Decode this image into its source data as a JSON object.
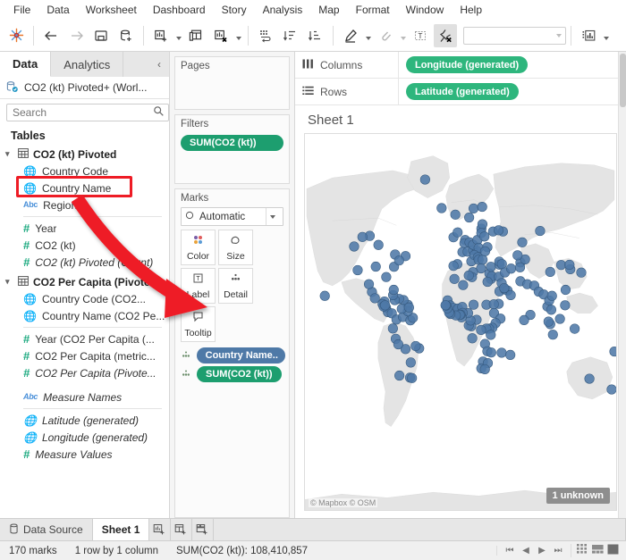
{
  "menu": {
    "items": [
      "File",
      "Data",
      "Worksheet",
      "Dashboard",
      "Story",
      "Analysis",
      "Map",
      "Format",
      "Window",
      "Help"
    ]
  },
  "toolbar": {
    "logo": "tableau-logo-icon",
    "back": "back-arrow-icon",
    "forward": "forward-arrow-icon",
    "save": "save-icon",
    "new_data_source": "new-data-source-icon",
    "new_worksheet": "new-worksheet-icon",
    "new_dashboard": "new-dashboard-icon",
    "clear_sheet": "clear-sheet-icon",
    "swap": "swap-rows-columns-icon",
    "sort_asc": "sort-ascending-icon",
    "sort_desc": "sort-descending-icon",
    "highlight": "highlight-icon",
    "group": "group-members-icon",
    "labels": "show-mark-labels-icon",
    "fix_axes": "fix-axes-icon",
    "fit_value": "",
    "fit_placeholder": "",
    "show_me": "show-me-icon"
  },
  "datapane": {
    "tabs": [
      {
        "label": "Data",
        "selected": true
      },
      {
        "label": "Analytics",
        "selected": false
      }
    ],
    "collapse_icon": "‹",
    "source": "CO2 (kt) Pivoted+ (Worl...",
    "search": {
      "placeholder": "Search",
      "value": ""
    },
    "search_icon": "search-icon",
    "filter_icon": "filter-icon",
    "grid_icon": "grid-view-icon",
    "grid_caret": "chevron-down-icon",
    "tables_header": "Tables",
    "tables": [
      {
        "name": "CO2 (kt) Pivoted",
        "fields": [
          {
            "label": "Country Code",
            "icon": "globe",
            "italic": false,
            "highlighted": false
          },
          {
            "label": "Country Name",
            "icon": "globe",
            "italic": false,
            "highlighted": true
          },
          {
            "label": "Region",
            "icon": "abc",
            "italic": false,
            "highlighted": false
          },
          {
            "label": "Year",
            "icon": "hash",
            "italic": false,
            "highlighted": false
          },
          {
            "label": "CO2 (kt)",
            "icon": "hash",
            "italic": false,
            "highlighted": false
          },
          {
            "label": "CO2 (kt) Pivoted (Count)",
            "icon": "hash",
            "italic": true,
            "highlighted": false
          }
        ]
      },
      {
        "name": "CO2 Per Capita (Pivoted)",
        "fields": [
          {
            "label": "Country Code (CO2...",
            "icon": "globe",
            "italic": false,
            "highlighted": false
          },
          {
            "label": "Country Name (CO2 Pe...",
            "icon": "globe",
            "italic": false,
            "highlighted": false
          },
          {
            "label": "Year (CO2 Per Capita (...",
            "icon": "hash",
            "italic": false,
            "highlighted": false
          },
          {
            "label": "CO2 Per Capita (metric...",
            "icon": "hash",
            "italic": false,
            "highlighted": false
          },
          {
            "label": "CO2 Per Capita (Pivote...",
            "icon": "hash",
            "italic": true,
            "highlighted": false
          }
        ]
      }
    ],
    "generated": [
      {
        "label": "Measure Names",
        "icon": "abc",
        "italic": true
      },
      {
        "label": "Latitude (generated)",
        "icon": "globe-green",
        "italic": true
      },
      {
        "label": "Longitude (generated)",
        "icon": "globe-green",
        "italic": true
      },
      {
        "label": "Measure Values",
        "icon": "hash",
        "italic": true
      }
    ]
  },
  "shelfpane": {
    "pages": {
      "title": "Pages"
    },
    "filters": {
      "title": "Filters",
      "pills": [
        "SUM(CO2 (kt))"
      ]
    },
    "marks": {
      "title": "Marks",
      "type": "Automatic",
      "type_icon": "circle-icon",
      "buttons": [
        {
          "label": "Color",
          "icon": "color-icon"
        },
        {
          "label": "Size",
          "icon": "size-icon"
        },
        {
          "label": "Label",
          "icon": "label-icon"
        },
        {
          "label": "Detail",
          "icon": "detail-icon"
        },
        {
          "label": "Tooltip",
          "icon": "tooltip-icon"
        }
      ],
      "pills": [
        {
          "label": "Country Name..",
          "color": "blue",
          "icon": "detail-icon"
        },
        {
          "label": "SUM(CO2 (kt))",
          "color": "green",
          "icon": "detail-icon"
        }
      ]
    }
  },
  "shelves": [
    {
      "name": "Columns",
      "icon": "columns-icon",
      "pills": [
        "Longitude (generated)"
      ]
    },
    {
      "name": "Rows",
      "icon": "rows-icon",
      "pills": [
        "Latitude (generated)"
      ]
    }
  ],
  "sheet": {
    "title": "Sheet 1",
    "map_attribution": "© Mapbox © OSM",
    "unknown_badge": "1 unknown"
  },
  "bottom_tabs": {
    "data_source": "Data Source",
    "data_source_icon": "data-source-icon",
    "sheets": [
      {
        "label": "Sheet 1",
        "selected": true
      }
    ],
    "new_worksheet_icon": "new-worksheet-icon",
    "new_dashboard_icon": "new-dashboard-icon",
    "new_story_icon": "new-story-icon"
  },
  "status": {
    "marks": "170 marks",
    "dimensions": "1 row by 1 column",
    "aggregate": "SUM(CO2 (kt)): 108,410,857",
    "nav": [
      "⏮",
      "◀",
      "▶",
      "⏭"
    ],
    "views": [
      "grid-view-icon",
      "filmstrip-view-icon",
      "sheet-view-icon"
    ]
  },
  "colors": {
    "tableau_green": "#1d9e6f",
    "shelf_green": "#2eb67d",
    "detail_blue": "#4e79a7",
    "mark_blue": "#4e79a7",
    "annotation_red": "#ee1c25",
    "land": "#e3e3e3",
    "water": "#ffffff"
  },
  "chart_data": {
    "type": "scatter",
    "title": "Sheet 1",
    "xlabel": "Longitude (generated)",
    "ylabel": "Latitude (generated)",
    "mark_count": 170,
    "mark_color": "#4e79a7",
    "unknown_locations": 1,
    "points": [
      [
        -21.9,
        64.1
      ],
      [
        -8.2,
        53.4
      ],
      [
        -3.4,
        55.4
      ],
      [
        -6.0,
        62.0
      ],
      [
        10.0,
        61.0
      ],
      [
        15.0,
        64.0
      ],
      [
        25.0,
        64.5
      ],
      [
        -41.0,
        71.7
      ],
      [
        5.3,
        52.2
      ],
      [
        4.5,
        50.8
      ],
      [
        2.2,
        46.6
      ],
      [
        10.4,
        51.2
      ],
      [
        8.2,
        46.8
      ],
      [
        14.5,
        47.5
      ],
      [
        12.5,
        41.9
      ],
      [
        -3.7,
        40.4
      ],
      [
        -8.2,
        39.4
      ],
      [
        19.1,
        47.2
      ],
      [
        14.5,
        50.1
      ],
      [
        19.5,
        52.2
      ],
      [
        21.0,
        48.7
      ],
      [
        16.0,
        45.1
      ],
      [
        20.0,
        44.0
      ],
      [
        21.0,
        42.7
      ],
      [
        25.5,
        42.7
      ],
      [
        23.7,
        38.0
      ],
      [
        33.4,
        35.1
      ],
      [
        14.4,
        35.9
      ],
      [
        24.1,
        56.9
      ],
      [
        25.3,
        58.6
      ],
      [
        24.0,
        55.2
      ],
      [
        27.6,
        53.7
      ],
      [
        31.0,
        49.0
      ],
      [
        28.4,
        47.0
      ],
      [
        35.2,
        31.8
      ],
      [
        36.2,
        33.5
      ],
      [
        44.4,
        33.2
      ],
      [
        35.2,
        38.9
      ],
      [
        45.0,
        40.1
      ],
      [
        44.8,
        41.7
      ],
      [
        47.9,
        40.4
      ],
      [
        51.4,
        35.7
      ],
      [
        45.0,
        24.0
      ],
      [
        47.5,
        29.3
      ],
      [
        51.5,
        25.3
      ],
      [
        54.4,
        24.5
      ],
      [
        50.5,
        26.1
      ],
      [
        58.0,
        21.5
      ],
      [
        44.2,
        15.6
      ],
      [
        31.2,
        30.0
      ],
      [
        13.2,
        32.9
      ],
      [
        9.5,
        33.9
      ],
      [
        3.0,
        28.0
      ],
      [
        -7.1,
        31.8
      ],
      [
        -15.0,
        18.0
      ],
      [
        -12.0,
        14.5
      ],
      [
        -8.0,
        12.7
      ],
      [
        -3.0,
        12.3
      ],
      [
        2.0,
        13.5
      ],
      [
        15.0,
        15.0
      ],
      [
        30.0,
        15.0
      ],
      [
        38.5,
        15.3
      ],
      [
        38.8,
        9.1
      ],
      [
        46.2,
        5.2
      ],
      [
        40.5,
        2.0
      ],
      [
        36.8,
        -1.3
      ],
      [
        32.9,
        -1.9
      ],
      [
        29.9,
        -1.9
      ],
      [
        34.9,
        -6.4
      ],
      [
        28.3,
        -12.8
      ],
      [
        31.0,
        -17.8
      ],
      [
        25.9,
        -24.7
      ],
      [
        24.0,
        -29.0
      ],
      [
        31.5,
        -25.7
      ],
      [
        28.2,
        -29.6
      ],
      [
        35.5,
        -18.7
      ],
      [
        47.5,
        -18.8
      ],
      [
        57.6,
        -20.3
      ],
      [
        13.5,
        -8.8
      ],
      [
        23.7,
        -2.9
      ],
      [
        18.5,
        4.4
      ],
      [
        12.4,
        -0.2
      ],
      [
        9.5,
        0.4
      ],
      [
        11.5,
        3.9
      ],
      [
        8.7,
        9.1
      ],
      [
        2.4,
        9.3
      ],
      [
        1.2,
        6.1
      ],
      [
        0.0,
        8.0
      ],
      [
        -1.0,
        7.9
      ],
      [
        -5.5,
        7.5
      ],
      [
        -11.8,
        8.5
      ],
      [
        -13.2,
        9.5
      ],
      [
        -15.3,
        12.5
      ],
      [
        -16.5,
        14.5
      ],
      [
        -17.4,
        14.7
      ],
      [
        -61.0,
        15.0
      ],
      [
        -66.0,
        18.2
      ],
      [
        -71.0,
        19.0
      ],
      [
        -76.0,
        18.1
      ],
      [
        -78.0,
        21.5
      ],
      [
        -88.0,
        17.2
      ],
      [
        -86.2,
        12.9
      ],
      [
        -84.1,
        9.9
      ],
      [
        -79.5,
        9.0
      ],
      [
        -90.2,
        15.5
      ],
      [
        -88.9,
        13.7
      ],
      [
        -87.2,
        14.6
      ],
      [
        -102.5,
        23.6
      ],
      [
        -106.0,
        28.6
      ],
      [
        -99.1,
        19.4
      ],
      [
        -74.1,
        4.6
      ],
      [
        -66.6,
        6.4
      ],
      [
        -58.0,
        4.0
      ],
      [
        -55.2,
        5.8
      ],
      [
        -78.2,
        -1.8
      ],
      [
        -75.0,
        -9.2
      ],
      [
        -63.6,
        -16.3
      ],
      [
        -70.7,
        -33.4
      ],
      [
        -58.4,
        -34.6
      ],
      [
        -56.2,
        -34.9
      ],
      [
        -57.6,
        -25.3
      ],
      [
        -47.9,
        -15.8
      ],
      [
        -51.9,
        -14.2
      ],
      [
        -72.0,
        -13.0
      ],
      [
        -61.0,
        10.4
      ],
      [
        -68.0,
        12.2
      ],
      [
        -59.6,
        13.1
      ],
      [
        -77.3,
        25.0
      ],
      [
        69.3,
        30.4
      ],
      [
        77.2,
        28.6
      ],
      [
        85.3,
        27.7
      ],
      [
        90.4,
        23.8
      ],
      [
        80.8,
        7.9
      ],
      [
        73.5,
        4.2
      ],
      [
        96.2,
        21.9
      ],
      [
        100.5,
        13.7
      ],
      [
        102.6,
        17.9
      ],
      [
        104.9,
        11.5
      ],
      [
        105.8,
        21.0
      ],
      [
        116.4,
        39.9
      ],
      [
        103.8,
        36.0
      ],
      [
        121.5,
        25.0
      ],
      [
        127.0,
        37.5
      ],
      [
        126.0,
        40.0
      ],
      [
        139.7,
        35.6
      ],
      [
        103.8,
        1.3
      ],
      [
        101.7,
        3.1
      ],
      [
        106.8,
        -6.2
      ],
      [
        120.9,
        14.6
      ],
      [
        115.0,
        5.0
      ],
      [
        132.0,
        -2.0
      ],
      [
        149.1,
        -35.3
      ],
      [
        174.8,
        -41.3
      ],
      [
        178.0,
        -18.0
      ],
      [
        71.4,
        51.2
      ],
      [
        69.2,
        41.3
      ],
      [
        58.4,
        37.9
      ],
      [
        74.6,
        42.9
      ],
      [
        68.8,
        38.6
      ],
      [
        66.0,
        45.0
      ],
      [
        37.6,
        55.8
      ],
      [
        92.0,
        56.0
      ],
      [
        49.0,
        55.8
      ],
      [
        44.0,
        56.3
      ],
      [
        -105.0,
        54.0
      ],
      [
        -95.0,
        50.0
      ],
      [
        -113.5,
        53.5
      ],
      [
        -123.1,
        49.3
      ],
      [
        -75.7,
        45.4
      ],
      [
        -63.6,
        44.6
      ],
      [
        -98.0,
        39.0
      ],
      [
        -119.0,
        37.0
      ],
      [
        -86.0,
        33.0
      ],
      [
        -77.0,
        38.9
      ],
      [
        -71.0,
        42.3
      ],
      [
        -157.0,
        21.0
      ]
    ]
  }
}
